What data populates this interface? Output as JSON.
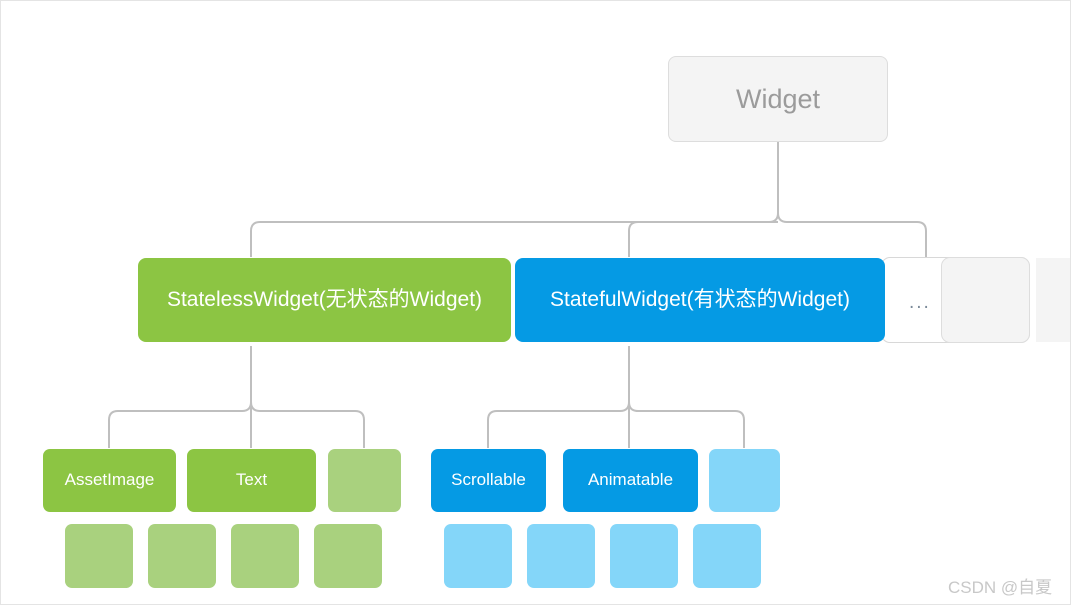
{
  "diagram": {
    "title_text": "Widget",
    "root": {
      "label": "Widget",
      "color": "#f4f4f4"
    },
    "level2": [
      {
        "label": "StatelessWidget(无状态的Widget)",
        "color": "#8cc543"
      },
      {
        "label": "StatefulWidget(有状态的Widget)",
        "color": "#059ae4"
      },
      {
        "label": "",
        "color": "#f4f4f4"
      }
    ],
    "ellipsis_label": "...",
    "stateless_children": [
      {
        "label": "AssetImage",
        "color": "#8cc543"
      },
      {
        "label": "Text",
        "color": "#8cc543"
      },
      {
        "label": "",
        "color": "#a9d17e"
      }
    ],
    "stateful_children": [
      {
        "label": "Scrollable",
        "color": "#059ae4"
      },
      {
        "label": "Animatable",
        "color": "#059ae4"
      },
      {
        "label": "",
        "color": "#84d6f9"
      }
    ],
    "stateless_grandchildren": [
      {
        "label": "",
        "color": "#a9d17e"
      },
      {
        "label": "",
        "color": "#a9d17e"
      },
      {
        "label": "",
        "color": "#a9d17e"
      },
      {
        "label": "",
        "color": "#a9d17e"
      }
    ],
    "stateful_grandchildren": [
      {
        "label": "",
        "color": "#84d6f9"
      },
      {
        "label": "",
        "color": "#84d6f9"
      },
      {
        "label": "",
        "color": "#84d6f9"
      },
      {
        "label": "",
        "color": "#84d6f9"
      }
    ],
    "edge_color": "#bfbfbf",
    "watermark": "CSDN @自夏"
  }
}
